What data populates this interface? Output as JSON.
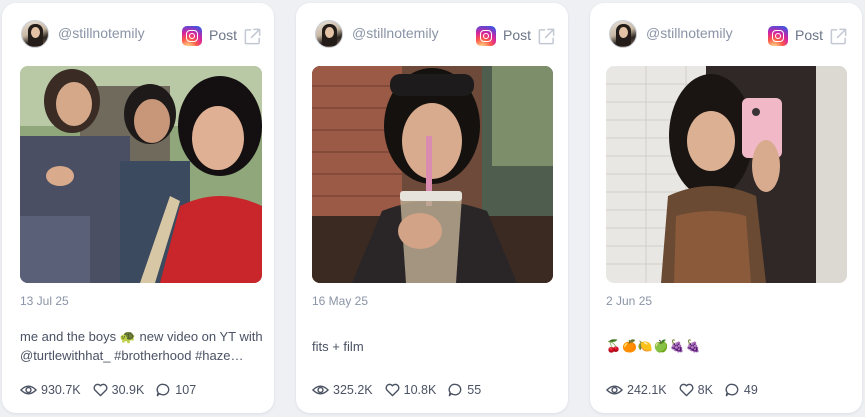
{
  "colors": {
    "page_bg": "#eef0f4",
    "card_bg": "#ffffff",
    "muted_text": "#8a94a6",
    "body_text": "#4a5263"
  },
  "cards": [
    {
      "username": "@stillnotemily",
      "platform": "instagram-icon",
      "post_label": "Post",
      "date": "13 Jul 25",
      "caption_line1": "me and the boys 🐢 new video on YT with",
      "caption_line2": "@turtlewithhat_ #brotherhood #haze…",
      "views": "930.7K",
      "likes": "30.9K",
      "comments": "107"
    },
    {
      "username": "@stillnotemily",
      "platform": "instagram-icon",
      "post_label": "Post",
      "date": "16 May 25",
      "caption_line1": "fits + film",
      "views": "325.2K",
      "likes": "10.8K",
      "comments": "55"
    },
    {
      "username": "@stillnotemily",
      "platform": "instagram-icon",
      "post_label": "Post",
      "date": "2 Jun 25",
      "caption_line1": "🍒🍊🍋🍏🍇🍇",
      "views": "242.1K",
      "likes": "8K",
      "comments": "49"
    }
  ]
}
